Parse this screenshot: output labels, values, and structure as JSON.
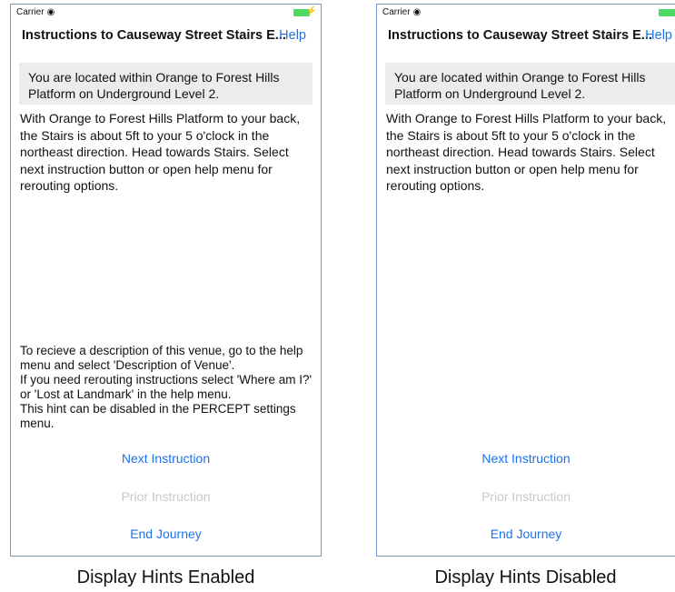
{
  "left_screen": {
    "status": {
      "carrier": "Carrier"
    },
    "nav": {
      "title": "Instructions to Causeway Street Stairs E...",
      "help": "Help"
    },
    "location": "You are located within Orange to Forest Hills Platform on Underground Level 2.",
    "instruction": "With Orange to Forest Hills Platform to your back, the Stairs is about 5ft to your 5 o'clock in the northeast direction.  Head towards Stairs.  Select next instruction button or open help menu for rerouting options.",
    "hint": [
      "To recieve a description of this venue, go to the help menu and select 'Description of Venue'.",
      "If you need rerouting instructions select 'Where am I?' or 'Lost at Landmark' in the help menu.",
      "This hint can be disabled in the PERCEPT settings menu."
    ],
    "buttons": {
      "next": "Next Instruction",
      "prior": "Prior Instruction",
      "end": "End Journey"
    },
    "caption": "Display Hints Enabled"
  },
  "right_screen": {
    "status": {
      "carrier": "Carrier"
    },
    "nav": {
      "title": "Instructions to Causeway Street Stairs E...",
      "help": "Help"
    },
    "location": "You are located within Orange to Forest Hills Platform on Underground Level 2.",
    "instruction": "With Orange to Forest Hills Platform to your back, the Stairs is about 5ft to your 5 o'clock in the northeast direction.  Head towards Stairs.  Select next instruction button or open help menu for rerouting options.",
    "buttons": {
      "next": "Next Instruction",
      "prior": "Prior Instruction",
      "end": "End Journey"
    },
    "caption": "Display Hints Disabled"
  },
  "colors": {
    "accent": "#1d72e8",
    "disabled": "#c9c9c9",
    "location_bg": "#ececec",
    "battery": "#4cd964"
  },
  "icons": [
    "wifi-icon",
    "battery-icon",
    "charging-bolt-icon"
  ]
}
